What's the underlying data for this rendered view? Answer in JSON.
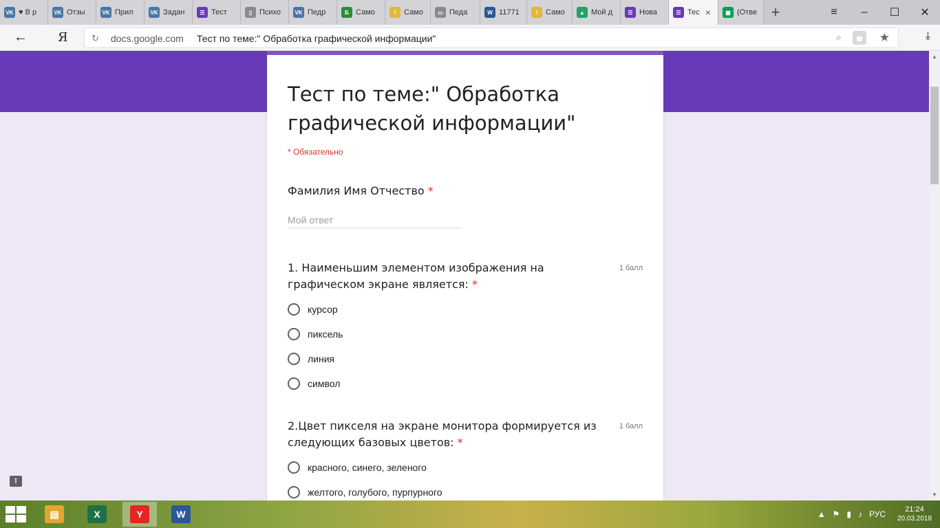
{
  "browser": {
    "tabs": [
      {
        "label": "♥ В р",
        "favicon": "vk-icon",
        "color": "#4a76a8",
        "glyph": "VK"
      },
      {
        "label": "Отзы",
        "favicon": "vk-icon",
        "color": "#4a76a8",
        "glyph": "VK"
      },
      {
        "label": "Прил",
        "favicon": "vk-icon",
        "color": "#4a76a8",
        "glyph": "VK"
      },
      {
        "label": "Задан",
        "favicon": "vk-icon",
        "color": "#4a76a8",
        "glyph": "VK"
      },
      {
        "label": "Тест",
        "favicon": "forms-icon",
        "color": "#673ab7",
        "glyph": "☰"
      },
      {
        "label": "Психо",
        "favicon": "document-icon",
        "color": "#8a8a8a",
        "glyph": "▯"
      },
      {
        "label": "Педр",
        "favicon": "vk-icon",
        "color": "#4a76a8",
        "glyph": "VK"
      },
      {
        "label": "Само",
        "favicon": "b-icon",
        "color": "#2e8b3c",
        "glyph": "Б"
      },
      {
        "label": "Само",
        "favicon": "pencil-icon",
        "color": "#e0b83a",
        "glyph": "i"
      },
      {
        "label": "Педа",
        "favicon": "presentation-icon",
        "color": "#8a8a8a",
        "glyph": "▭"
      },
      {
        "label": "11771",
        "favicon": "word-doc-icon",
        "color": "#2b5797",
        "glyph": "W"
      },
      {
        "label": "Само",
        "favicon": "pencil-icon",
        "color": "#e0b83a",
        "glyph": "i"
      },
      {
        "label": "Мой д",
        "favicon": "drive-icon",
        "color": "#1fa463",
        "glyph": "▲"
      },
      {
        "label": "Нова",
        "favicon": "forms-icon",
        "color": "#673ab7",
        "glyph": "☰"
      },
      {
        "label": "Тес",
        "favicon": "forms-icon",
        "color": "#673ab7",
        "glyph": "☰",
        "active": true
      },
      {
        "label": "(Отве",
        "favicon": "sheets-icon",
        "color": "#0f9d58",
        "glyph": "▦"
      }
    ],
    "tab_add": "+",
    "tab_close": "×",
    "window_controls": {
      "menu": "≡",
      "minimize": "–",
      "maximize": "☐",
      "close": "✕"
    },
    "nav": {
      "back": "←",
      "yandex": "Я",
      "reload": "↻"
    },
    "url": {
      "domain": "docs.google.com",
      "title": "Тест по теме:\" Обработка графической информации\""
    },
    "icons": {
      "zoom": "⌕",
      "star": "★",
      "download": "⤓"
    }
  },
  "form": {
    "title": "Тест по теме:\" Обработка графической информации\"",
    "required_note": "* Обязательно",
    "required_star": "*",
    "name_question": {
      "label": "Фамилия Имя Отчество",
      "placeholder": "Мой ответ"
    },
    "questions": [
      {
        "text": "1. Наименьшим элементом изображения на графическом экране является:",
        "points": "1 балл",
        "options": [
          "курсор",
          "пиксель",
          "линия",
          "символ"
        ]
      },
      {
        "text": "2.Цвет пикселя на экране монитора формируется из следующих базовых цветов:",
        "points": "1 балл",
        "options": [
          "красного, синего, зеленого",
          "желтого, голубого, пурпурного"
        ]
      }
    ],
    "feedback_glyph": "!"
  },
  "taskbar": {
    "apps": [
      {
        "name": "file-explorer",
        "glyph": "▤",
        "color": "#e0a630"
      },
      {
        "name": "excel",
        "glyph": "X",
        "color": "#1e7145"
      },
      {
        "name": "yandex-browser",
        "glyph": "Y",
        "color": "#e52620",
        "active": true
      },
      {
        "name": "word",
        "glyph": "W",
        "color": "#2b5797"
      }
    ],
    "tray": {
      "lang": "РУС",
      "time": "21:24",
      "date": "20.03.2018"
    }
  },
  "colors": {
    "brand": "#673ab7",
    "background": "#ede7f6",
    "required": "#d93025"
  }
}
